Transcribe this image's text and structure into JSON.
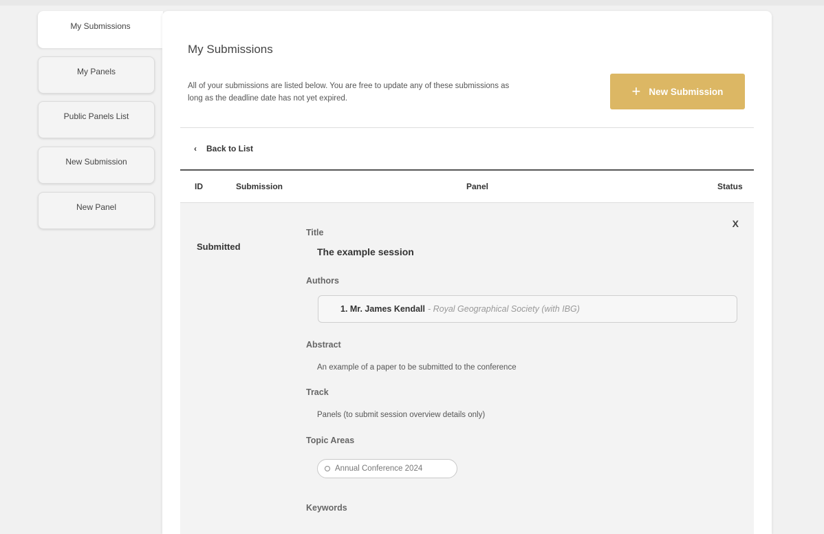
{
  "sidebar": {
    "items": [
      {
        "label": "My Submissions",
        "active": true
      },
      {
        "label": "My Panels"
      },
      {
        "label": "Public Panels List"
      },
      {
        "label": "New Submission"
      },
      {
        "label": "New Panel"
      }
    ]
  },
  "main": {
    "title": "My Submissions",
    "intro": "All of your submissions are listed below. You are free to update any of these submissions as long as the deadline date has not yet expired.",
    "new_button": {
      "icon": "+",
      "label": "New Submission"
    },
    "back": {
      "icon": "‹",
      "label": "Back to List"
    },
    "table": {
      "headers": {
        "id": "ID",
        "submission": "Submission",
        "panel": "Panel",
        "status": "Status"
      }
    },
    "detail": {
      "close": "X",
      "status": "Submitted",
      "title_label": "Title",
      "title_value": "The example session",
      "authors_label": "Authors",
      "author_name": "1. Mr. James Kendall",
      "author_affiliation": "- Royal Geographical Society (with IBG)",
      "abstract_label": "Abstract",
      "abstract_value": "An example of a paper to be submitted to the conference",
      "track_label": "Track",
      "track_value": "Panels (to submit session overview details only)",
      "topics_label": "Topic Areas",
      "topic": "Annual Conference 2024",
      "keywords_label": "Keywords"
    }
  },
  "colors": {
    "accent": "#dcb764",
    "panel_bg": "#f3f3f3",
    "page_bg": "#f1f1f1"
  }
}
